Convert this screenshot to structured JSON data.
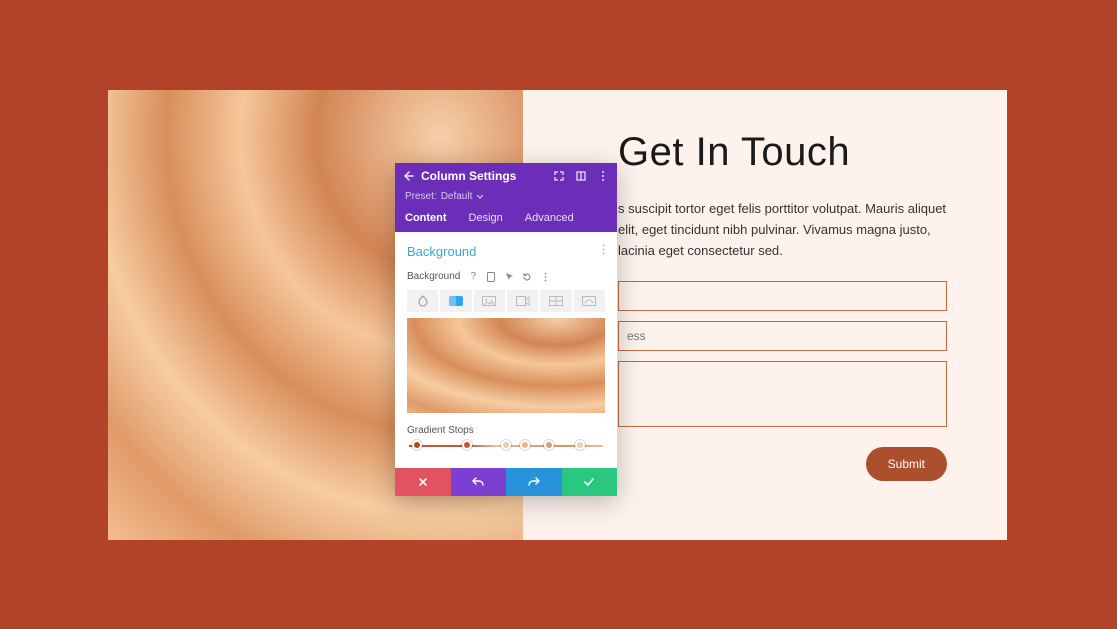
{
  "page": {
    "title": "Get In Touch",
    "body": "s suscipit tortor eget felis porttitor volutpat. Mauris aliquet elit, eget tincidunt nibh pulvinar. Vivamus magna justo, lacinia eget consectetur sed.",
    "email_placeholder": "ess",
    "submit": "Submit"
  },
  "modal": {
    "title": "Column Settings",
    "preset_label": "Preset:",
    "preset_value": "Default",
    "tabs": {
      "content": "Content",
      "design": "Design",
      "advanced": "Advanced"
    },
    "section_title": "Background",
    "field_label": "Background",
    "gradient_stops_label": "Gradient Stops",
    "bg_type_icons": [
      "palette-icon",
      "gradient-icon",
      "image-icon",
      "video-icon",
      "pattern-icon",
      "mask-icon"
    ],
    "stops": [
      {
        "pos": 4,
        "color": "#b84a22"
      },
      {
        "pos": 30,
        "color": "#c1572b"
      },
      {
        "pos": 50,
        "color": "#eecaa8"
      },
      {
        "pos": 60,
        "color": "#e7b58c"
      },
      {
        "pos": 72,
        "color": "#dd9e6f"
      },
      {
        "pos": 88,
        "color": "#efcfad"
      }
    ],
    "colors": {
      "header": "#6c2eb9",
      "cancel": "#e15361",
      "undo": "#7d3fd1",
      "redo": "#2893d8",
      "ok": "#29c77f"
    }
  }
}
